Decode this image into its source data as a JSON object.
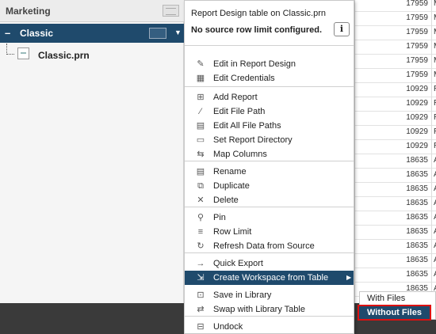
{
  "left_panel": {
    "group_label": "Marketing",
    "workspace_label": "Classic",
    "file_label": "Classic.prn"
  },
  "table": {
    "rows": [
      {
        "num": "17959",
        "txt": "M"
      },
      {
        "num": "17959",
        "txt": "M"
      },
      {
        "num": "17959",
        "txt": "M"
      },
      {
        "num": "17959",
        "txt": "M"
      },
      {
        "num": "17959",
        "txt": "M"
      },
      {
        "num": "17959",
        "txt": "M"
      },
      {
        "num": "10929",
        "txt": "R"
      },
      {
        "num": "10929",
        "txt": "R"
      },
      {
        "num": "10929",
        "txt": "R"
      },
      {
        "num": "10929",
        "txt": "R"
      },
      {
        "num": "10929",
        "txt": "R"
      },
      {
        "num": "18635",
        "txt": "A"
      },
      {
        "num": "18635",
        "txt": "A"
      },
      {
        "num": "18635",
        "txt": "A"
      },
      {
        "num": "18635",
        "txt": "A"
      },
      {
        "num": "18635",
        "txt": "A"
      },
      {
        "num": "18635",
        "txt": "A"
      },
      {
        "num": "18635",
        "txt": "A"
      },
      {
        "num": "18635",
        "txt": "A"
      },
      {
        "num": "18635",
        "txt": "A"
      },
      {
        "num": "18635",
        "txt": "A"
      }
    ]
  },
  "menu": {
    "title": "Report Design table on Classic.prn",
    "subtitle": "No source row limit configured.",
    "info_glyph": "i",
    "items": [
      {
        "label": "Edit in Report Design",
        "icon": "pencil-icon",
        "glyph": "✎"
      },
      {
        "label": "Edit Credentials",
        "icon": "credentials-icon",
        "glyph": "▦"
      },
      {
        "label": "Add Report",
        "icon": "add-report-icon",
        "glyph": "⊞"
      },
      {
        "label": "Edit File Path",
        "icon": "file-path-icon",
        "glyph": "⁄"
      },
      {
        "label": "Edit All File Paths",
        "icon": "all-paths-icon",
        "glyph": "▤"
      },
      {
        "label": "Set Report Directory",
        "icon": "folder-icon",
        "glyph": "▭"
      },
      {
        "label": "Map Columns",
        "icon": "map-columns-icon",
        "glyph": "⇆"
      },
      {
        "label": "Rename",
        "icon": "rename-icon",
        "glyph": "▤"
      },
      {
        "label": "Duplicate",
        "icon": "duplicate-icon",
        "glyph": "⧉"
      },
      {
        "label": "Delete",
        "icon": "delete-icon",
        "glyph": "✕"
      },
      {
        "label": "Pin",
        "icon": "pin-icon",
        "glyph": "⚲"
      },
      {
        "label": "Row Limit",
        "icon": "row-limit-icon",
        "glyph": "≡"
      },
      {
        "label": "Refresh Data from Source",
        "icon": "refresh-icon",
        "glyph": "↻"
      },
      {
        "label": "Quick Export",
        "icon": "export-icon",
        "glyph": "→"
      },
      {
        "label": "Create Workspace from Table",
        "icon": "workspace-icon",
        "glyph": "⇲"
      },
      {
        "label": "Save in Library",
        "icon": "library-save-icon",
        "glyph": "⊡"
      },
      {
        "label": "Swap with Library Table",
        "icon": "swap-icon",
        "glyph": "⇄"
      },
      {
        "label": "Undock",
        "icon": "undock-icon",
        "glyph": "⊟"
      }
    ]
  },
  "submenu": {
    "with_files": "With Files",
    "without_files": "Without Files"
  },
  "colors": {
    "accent": "#1f4a6c",
    "highlight_border": "#dd1111"
  }
}
